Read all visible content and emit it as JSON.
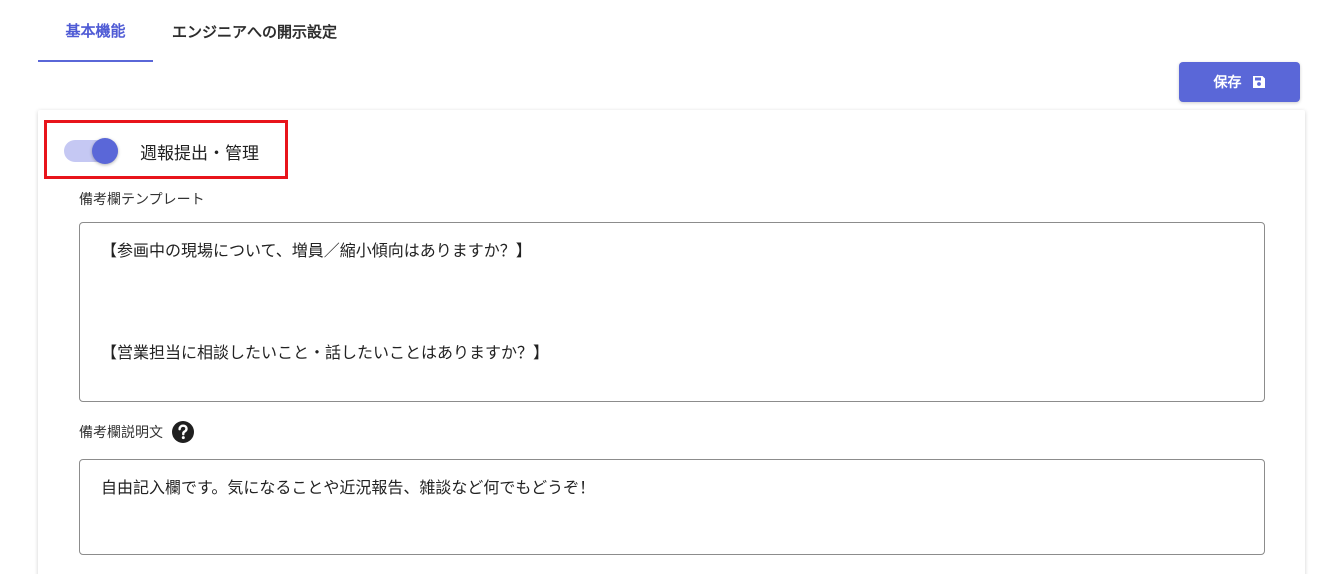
{
  "tabs": [
    {
      "label": "基本機能",
      "active": true
    },
    {
      "label": "エンジニアへの開示設定",
      "active": false
    }
  ],
  "save_button": {
    "label": "保存",
    "icon": "floppy-disk-icon"
  },
  "toggle": {
    "label": "週報提出・管理",
    "on": true
  },
  "remarks_template": {
    "label": "備考欄テンプレート",
    "lines": [
      "【参画中の現場について、増員／縮小傾向はありますか？】",
      "",
      "",
      "【営業担当に相談したいこと・話したいことはありますか？】"
    ]
  },
  "remarks_description": {
    "label": "備考欄説明文",
    "icon": "question-circle-icon",
    "value": "自由記入欄です。気になることや近況報告、雑談など何でもどうぞ！"
  },
  "colors": {
    "accent": "#5a67d8",
    "toggle_track": "#c5c8f3",
    "highlight": "#e8141b"
  }
}
